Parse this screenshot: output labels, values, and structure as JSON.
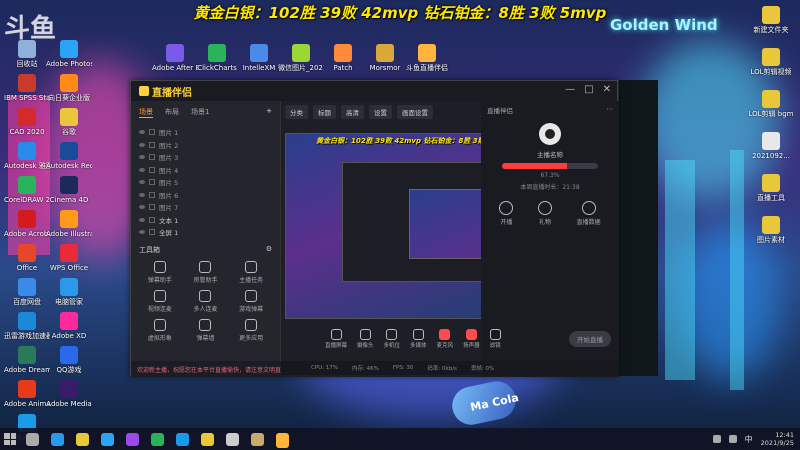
{
  "overlay": {
    "banner": "黄金白银：102胜 39败 42mvp 钻石铂金：8胜 3败 5mvp",
    "logo": "斗鱼"
  },
  "wallpaper": {
    "neon_golden_wind": "Golden Wind",
    "can_text": "Ma Cola"
  },
  "desktop_icons_left": [
    {
      "label": "回收站",
      "color": "#8fb0d8"
    },
    {
      "label": "Adobe Photoshop",
      "color": "#2aa4f4"
    },
    {
      "label": "IBM SPSS Statistics 21",
      "color": "#c83a2c"
    },
    {
      "label": "向日葵企业版",
      "color": "#ff8a1a"
    },
    {
      "label": "CAD 2020",
      "color": "#d42a2a"
    },
    {
      "label": "谷歌",
      "color": "#e8c83a"
    },
    {
      "label": "Autodesk 雅图",
      "color": "#2a8ae8"
    },
    {
      "label": "Autodesk Recap",
      "color": "#1a4a9a"
    },
    {
      "label": "CorelDRAW 2020 (64 ...)",
      "color": "#28b45a"
    },
    {
      "label": "Cinema 4D",
      "color": "#1a2a5a"
    },
    {
      "label": "Adobe Acrobat",
      "color": "#d41a1a"
    },
    {
      "label": "Adobe Illustrator",
      "color": "#ff9a1a"
    },
    {
      "label": "Office",
      "color": "#e8462a"
    },
    {
      "label": "WPS Office",
      "color": "#e82a3a"
    },
    {
      "label": "百度网盘",
      "color": "#3a8ae8"
    },
    {
      "label": "电脑管家",
      "color": "#2a9ae8"
    },
    {
      "label": "迅雷游戏加速器",
      "color": "#1a8ad8"
    },
    {
      "label": "Adobe XD",
      "color": "#ff2a9a"
    },
    {
      "label": "Adobe Dreamweaver",
      "color": "#2a7a5a"
    },
    {
      "label": "QQ游戏",
      "color": "#2a6ae8"
    },
    {
      "label": "Adobe Animate",
      "color": "#e83a1a"
    },
    {
      "label": "Adobe Media",
      "color": "#3a1a6a"
    },
    {
      "label": "腾讯QQ",
      "color": "#1a9ae8"
    }
  ],
  "desktop_icons_top": [
    {
      "label": "Adobe After Effects CC",
      "color": "#7a5ae8"
    },
    {
      "label": "ClickCharts",
      "color": "#2ab45a"
    },
    {
      "label": "IntelleXM",
      "color": "#4a8ae8"
    },
    {
      "label": "微信图片_2021...",
      "color": "#9ad83a"
    },
    {
      "label": "Patch",
      "color": "#ff8a3a"
    },
    {
      "label": "Morsmor",
      "color": "#d8a83a"
    },
    {
      "label": "斗鱼直播伴侣",
      "color": "#ffb43c"
    }
  ],
  "desktop_icons_right": [
    {
      "label": "新建文件夹",
      "color": "#e8c83a"
    },
    {
      "label": "LOL剪辑视频",
      "color": "#e8c83a"
    },
    {
      "label": "LOL剪辑 bgm",
      "color": "#e8c83a"
    },
    {
      "label": "2021092...",
      "color": "#e8e8e8"
    },
    {
      "label": "直播工具",
      "color": "#e8c83a"
    },
    {
      "label": "图片素材",
      "color": "#e8c83a"
    }
  ],
  "app": {
    "name": "直播伴侣",
    "tabs": [
      "场景",
      "布局",
      "场景1"
    ],
    "scenes": [
      {
        "label": "图片 1",
        "on": false
      },
      {
        "label": "图片 2",
        "on": false
      },
      {
        "label": "图片 3",
        "on": false
      },
      {
        "label": "图片 4",
        "on": false
      },
      {
        "label": "图片 5",
        "on": false
      },
      {
        "label": "图片 6",
        "on": false
      },
      {
        "label": "图片 7",
        "on": false
      },
      {
        "label": "文本 1",
        "on": true
      },
      {
        "label": "全屏 1",
        "on": true
      }
    ],
    "tools_title": "工具箱",
    "tools": [
      {
        "label": "弹幕助手"
      },
      {
        "label": "房管助手"
      },
      {
        "label": "主播任务"
      },
      {
        "label": "视频连麦"
      },
      {
        "label": "多人连麦"
      },
      {
        "label": "游戏弹幕"
      },
      {
        "label": "虚拟形象"
      },
      {
        "label": "弹幕墙"
      },
      {
        "label": "更多应用"
      }
    ],
    "chat_notice": "欢迎新主播，祝愿您在本平台直播愉快，请注意文明直播",
    "top_pills": [
      "分类",
      "标题",
      "高清",
      "设置",
      "画面设置"
    ],
    "panel": {
      "title": "直播伴侣",
      "user": "主播名称",
      "level_text": "67.3%",
      "level_pct": 67.3,
      "sub": "本周直播时长：21:38",
      "actions": [
        "开播",
        "礼物",
        "直播数据"
      ]
    },
    "bottom_tools": [
      "直播屏幕",
      "摄像头",
      "多机位",
      "多媒体",
      "麦克风",
      "扬声器",
      "滤镜"
    ],
    "go_live": "开始直播",
    "status": [
      "CPU: 17%",
      "内存: 46%",
      "FPS: 30",
      "码率: 0kb/s",
      "丢帧: 0%"
    ]
  },
  "taskbar": {
    "apps": [
      {
        "name": "search-icon",
        "color": "#aaaaaa"
      },
      {
        "name": "edge",
        "color": "#2a9ae8"
      },
      {
        "name": "chrome",
        "color": "#e8c83a"
      },
      {
        "name": "photoshop",
        "color": "#2aa4f4"
      },
      {
        "name": "premiere",
        "color": "#9a4ae8"
      },
      {
        "name": "wechat",
        "color": "#2ab45a"
      },
      {
        "name": "qq",
        "color": "#1a9ae8"
      },
      {
        "name": "chrome2",
        "color": "#e8c83a"
      },
      {
        "name": "search2",
        "color": "#cccccc"
      },
      {
        "name": "lol",
        "color": "#c8aa6e"
      },
      {
        "name": "douyu",
        "color": "#ffb43c"
      }
    ],
    "ime": "中",
    "time": "12:41",
    "date": "2021/9/25"
  }
}
